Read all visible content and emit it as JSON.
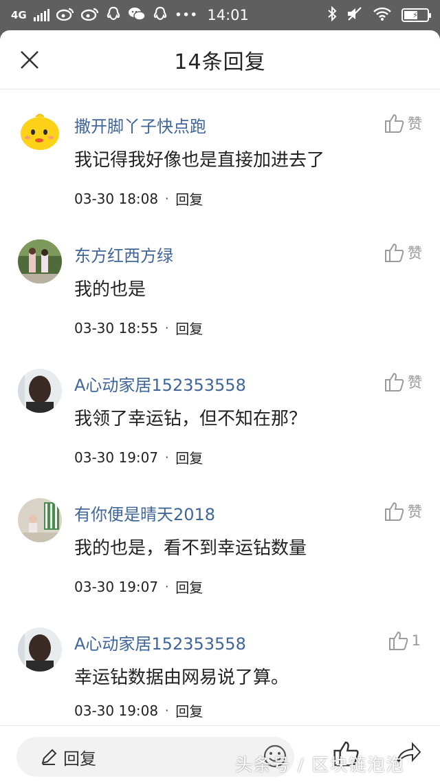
{
  "status_bar": {
    "network": "4G",
    "time": "14:01",
    "icons": [
      "weibo-icon",
      "weibo-icon",
      "qq-icon",
      "wechat-icon",
      "qq-icon",
      "more-icon",
      "bluetooth-icon",
      "mute-icon",
      "wifi-icon",
      "battery-icon"
    ],
    "battery_level": 0.6
  },
  "header": {
    "title": "14条回复",
    "close_icon": "close-icon"
  },
  "comments": [
    {
      "user": "撒开脚丫子快点跑",
      "text": "我记得我好像也是直接加进去了",
      "time": "03-30 18:08",
      "reply_label": "回复",
      "like_label": "赞"
    },
    {
      "user": "东方红西方绿",
      "text": "我的也是",
      "time": "03-30 18:55",
      "reply_label": "回复",
      "like_label": "赞"
    },
    {
      "user": "A心动家居152353558",
      "text": "我领了幸运钻，但不知在那？",
      "time": "03-30 19:07",
      "reply_label": "回复",
      "like_label": "赞"
    },
    {
      "user": "有你便是晴天2018",
      "text": "我的也是，看不到幸运钻数量",
      "time": "03-30 19:07",
      "reply_label": "回复",
      "like_label": "赞"
    },
    {
      "user": "A心动家居152353558",
      "text": "幸运钻数据由网易说了算。",
      "time": "03-30 19:08",
      "reply_label": "回复",
      "like_label": "1"
    }
  ],
  "meta_separator": "·",
  "bottom_bar": {
    "reply_placeholder": "回复",
    "icons": [
      "pencil-icon",
      "emoji-icon",
      "thumbs-up-icon",
      "share-icon"
    ]
  },
  "watermark": "头条号 / 区块链泡泡",
  "colors": {
    "username": "#406599",
    "text": "#222222",
    "like": "#9a9a9a",
    "statusbar_bg": "#5f5f5f"
  }
}
